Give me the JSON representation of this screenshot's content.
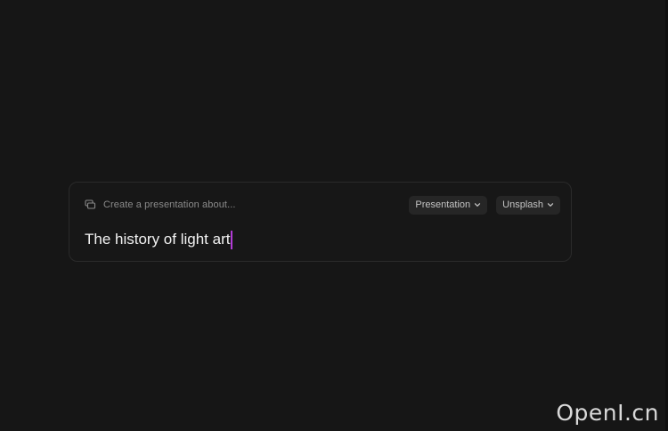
{
  "prompt": {
    "hint": "Create a presentation about...",
    "value": "The history of light art",
    "icons": {
      "type_icon": "presentation-deck-icon",
      "chevron": "chevron-down-icon"
    },
    "type_selector": {
      "label": "Presentation"
    },
    "image_source_selector": {
      "label": "Unsplash"
    }
  },
  "colors": {
    "background": "#161616",
    "card_border": "#2a2a2a",
    "caret": "#b23bd6"
  },
  "watermark": "OpenI.cn"
}
